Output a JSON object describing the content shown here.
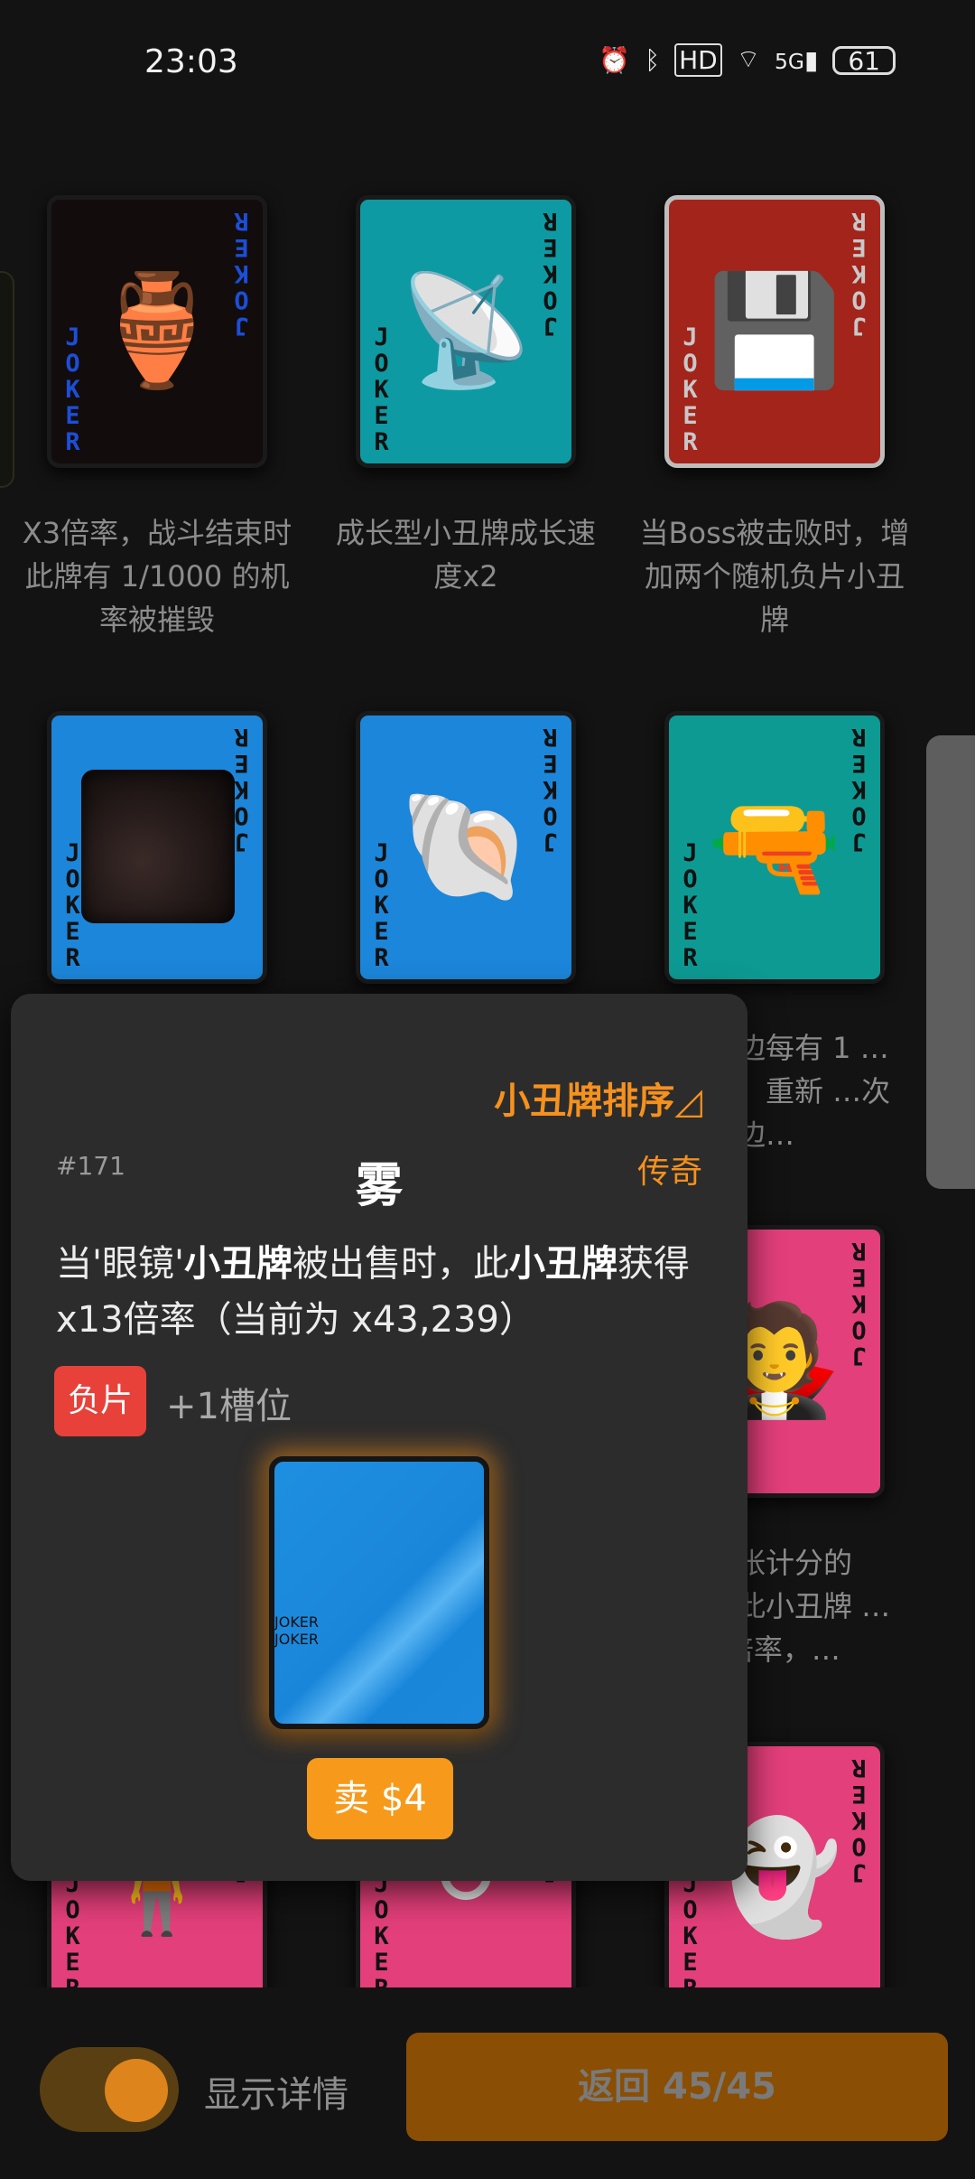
{
  "status": {
    "time": "23:03",
    "battery": "61",
    "network": "5G",
    "hd": "HD"
  },
  "jokers": [
    {
      "desc": "X3倍率，战斗结束时此牌有 1/1000 的机率被摧毁",
      "art": "🏺",
      "bg": "#120c0c",
      "jokerColor": "#1c4ed8"
    },
    {
      "desc": "成长型小丑牌成长速度x2",
      "art": "📡",
      "bg": "#0e9aa2",
      "jokerColor": "#111111"
    },
    {
      "desc": "当Boss被击败时，增加两个随机负片小丑牌",
      "art": "💾",
      "bg": "#a3241b",
      "jokerColor": "#c8c8c8"
    },
    {
      "desc": "",
      "art": "",
      "bg": "#1c86da",
      "jokerColor": "#111111"
    },
    {
      "desc": "",
      "art": "🐚",
      "bg": "#1c86da",
      "jokerColor": "#111111"
    },
    {
      "desc": "…右边每有 1 …小丑，重新 …次其左边…",
      "art": "🔫",
      "bg": "#0d9a93",
      "jokerColor": "#111111"
    },
    {
      "desc": "…一张计分的 …，此小丑牌 …0.1倍率，…",
      "art": "🧛",
      "bg": "#e33f7a",
      "jokerColor": "#111111"
    },
    {
      "desc": "",
      "art": "🧍",
      "bg": "#e33f7a",
      "jokerColor": "#111111"
    },
    {
      "desc": "",
      "art": "⚪",
      "bg": "#e33f7a",
      "jokerColor": "#111111"
    },
    {
      "desc": "",
      "art": "👻",
      "bg": "#e33f7a",
      "jokerColor": "#111111"
    }
  ],
  "joker_word": "JOKER",
  "popup": {
    "sort_label": "小丑牌排序◿",
    "number": "#171",
    "title": "雾",
    "rarity": "传奇",
    "body_1": "当'眼镜'",
    "body_2": "小丑牌",
    "body_3": "被出售时，此",
    "body_4": "小丑牌",
    "body_5": "获得 x13倍率（当前为 x43,239）",
    "negative_label": "负片",
    "slot_label": "+1槽位",
    "sell_label": "卖 $4"
  },
  "bottom": {
    "toggle_label": "显示详情",
    "back_label": "返回 45/45",
    "toggle_on": true
  },
  "colors": {
    "accent": "#f5911e",
    "negative": "#e8413a"
  }
}
